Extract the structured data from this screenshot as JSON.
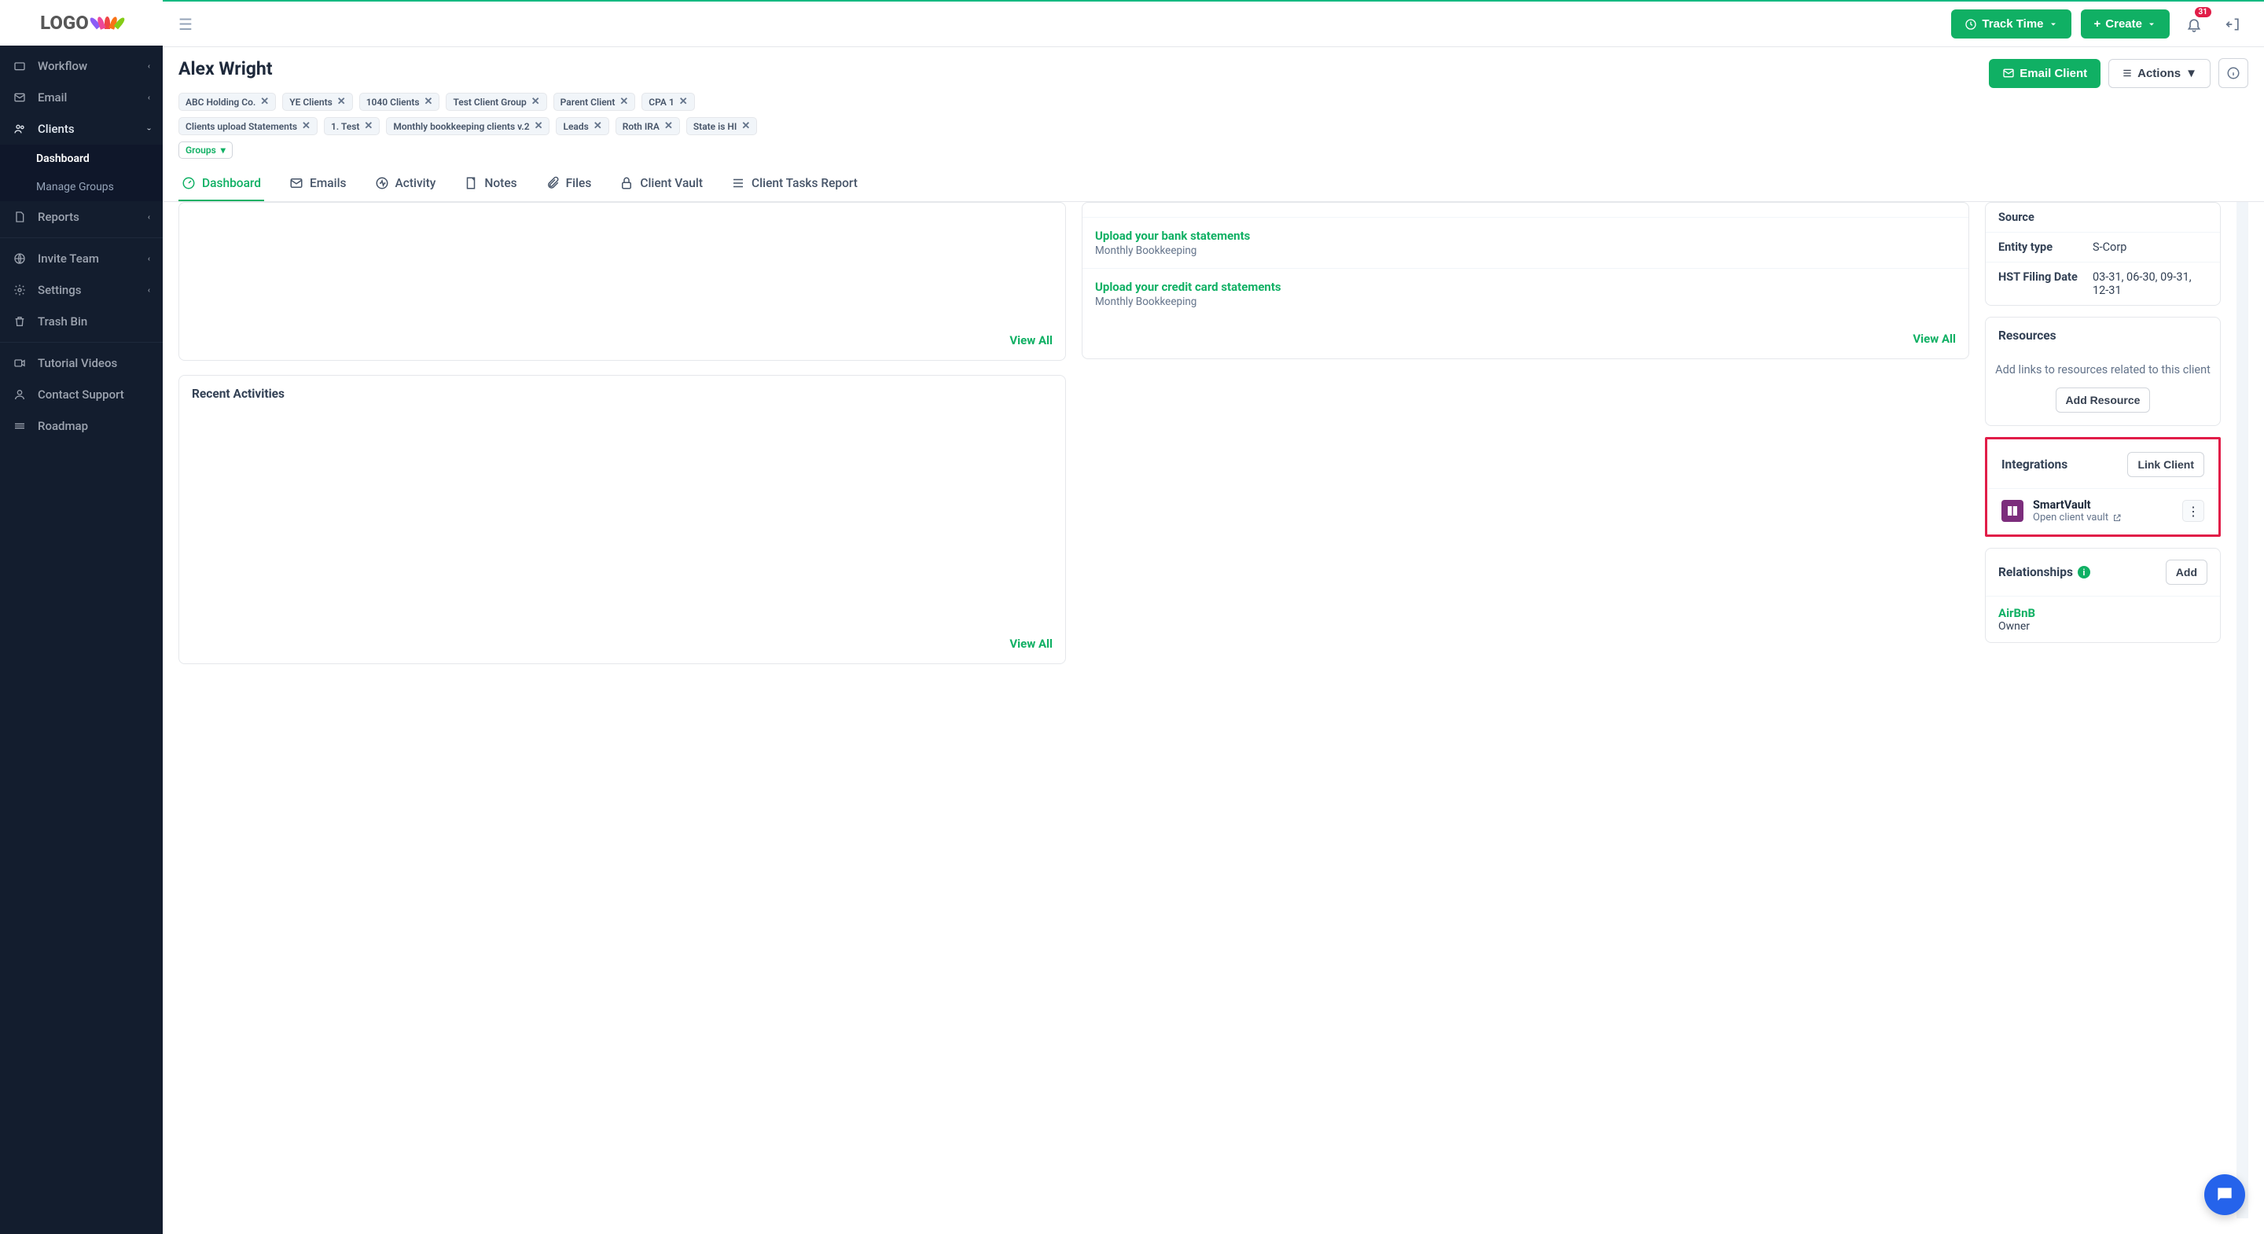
{
  "notifications_count": "31",
  "topbar": {
    "track_time": "Track Time",
    "create": "Create"
  },
  "sidebar": {
    "items": [
      {
        "label": "Workflow"
      },
      {
        "label": "Email"
      },
      {
        "label": "Clients"
      },
      {
        "label": "Reports"
      },
      {
        "label": "Invite Team"
      },
      {
        "label": "Settings"
      },
      {
        "label": "Trash Bin"
      },
      {
        "label": "Tutorial Videos"
      },
      {
        "label": "Contact Support"
      },
      {
        "label": "Roadmap"
      }
    ],
    "clients_sub": [
      {
        "label": "Dashboard"
      },
      {
        "label": "Manage Groups"
      }
    ]
  },
  "client": {
    "name": "Alex Wright"
  },
  "tags": [
    "ABC Holding Co.",
    "YE Clients",
    "1040 Clients",
    "Test Client Group",
    "Parent Client",
    "CPA 1",
    "Clients upload Statements",
    "1. Test",
    "Monthly bookkeeping clients v.2",
    "Leads",
    "Roth IRA",
    "State is HI"
  ],
  "groups_label": "Groups",
  "header_actions": {
    "email_client": "Email Client",
    "actions": "Actions"
  },
  "tabs": [
    "Dashboard",
    "Emails",
    "Activity",
    "Notes",
    "Files",
    "Client Vault",
    "Client Tasks Report"
  ],
  "tasks": [
    {
      "title": "Upload your bank statements",
      "sub": "Monthly Bookkeeping"
    },
    {
      "title": "Upload your credit card statements",
      "sub": "Monthly Bookkeeping"
    }
  ],
  "view_all": "View All",
  "recent_activities_title": "Recent Activities",
  "details": {
    "rows": [
      {
        "key": "Source",
        "val": ""
      },
      {
        "key": "Entity type",
        "val": "S-Corp"
      },
      {
        "key": "HST Filing Date",
        "val": "03-31, 06-30, 09-31, 12-31"
      }
    ]
  },
  "resources": {
    "title": "Resources",
    "hint": "Add links to resources related to this client",
    "add": "Add Resource"
  },
  "integrations": {
    "title": "Integrations",
    "link": "Link Client",
    "item": {
      "name": "SmartVault",
      "sub": "Open client vault"
    }
  },
  "relationships": {
    "title": "Relationships",
    "add": "Add",
    "items": [
      {
        "name": "AirBnB",
        "role": "Owner"
      }
    ]
  }
}
